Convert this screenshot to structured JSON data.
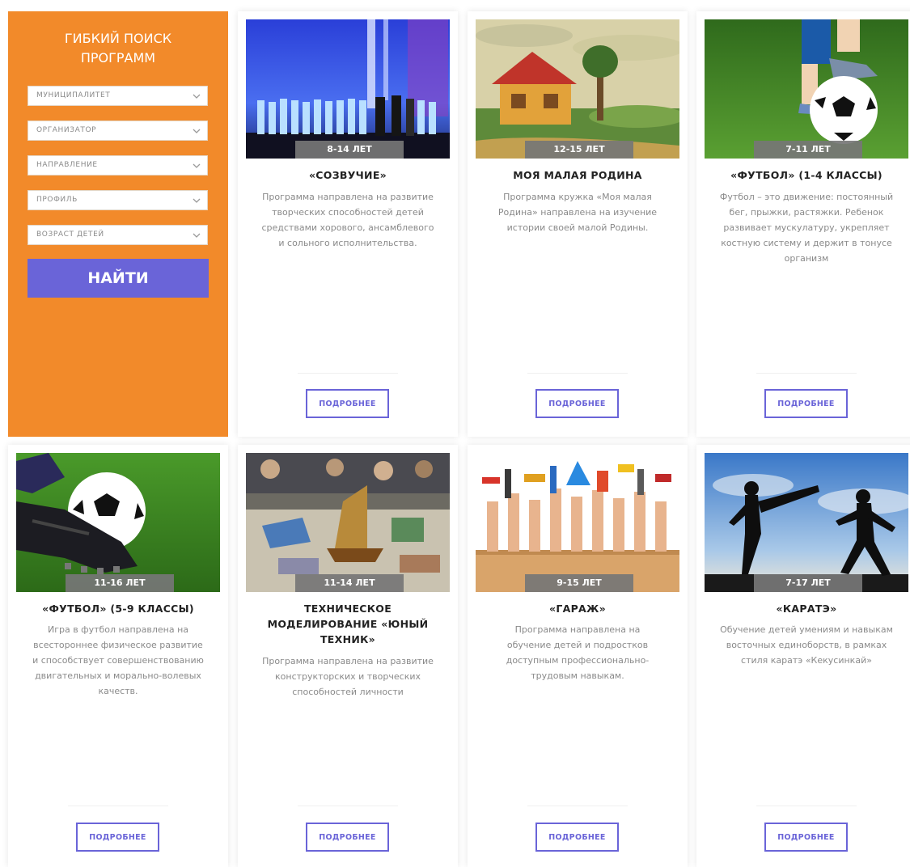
{
  "search": {
    "title_line1": "ГИБКИЙ ПОИСК",
    "title_line2": "ПРОГРАММ",
    "filters": [
      {
        "label": "МУНИЦИПАЛИТЕТ"
      },
      {
        "label": "ОРГАНИЗАТОР"
      },
      {
        "label": "НАПРАВЛЕНИЕ"
      },
      {
        "label": "ПРОФИЛЬ"
      },
      {
        "label": "ВОЗРАСТ ДЕТЕЙ"
      }
    ],
    "button_label": "НАЙТИ",
    "accent_color": "#f28a2a",
    "button_color": "#6a64d8"
  },
  "cards": [
    {
      "age": "8-14 ЛЕТ",
      "title_lines": [
        "«СОЗВУЧИЕ»"
      ],
      "desc_lines": [
        "Программа направлена на развитие",
        "творческих способностей детей",
        "средствами хорового, ансамблевого",
        "и сольного исполнительства."
      ],
      "button": "ПОДРОБНЕЕ",
      "image": "choir-stage"
    },
    {
      "age": "12-15 ЛЕТ",
      "title_lines": [
        "МОЯ МАЛАЯ РОДИНА"
      ],
      "desc_lines": [
        "Программа кружка «Моя малая",
        "Родина» направлена на изучение",
        "истории своей малой Родины."
      ],
      "button": "ПОДРОБНЕЕ",
      "image": "house-painting"
    },
    {
      "age": "7-11 ЛЕТ",
      "title_lines": [
        "«ФУТБОЛ» (1-4 КЛАССЫ)"
      ],
      "desc_lines": [
        "Футбол – это движение: постоянный",
        "бег, прыжки, растяжки. Ребенок",
        "развивает мускулатуру, укрепляет",
        "костную систему и держит в тонусе",
        "организм"
      ],
      "button": "ПОДРОБНЕЕ",
      "image": "football-kid"
    },
    {
      "age": "11-16 ЛЕТ",
      "title_lines": [
        "«ФУТБОЛ» (5-9 КЛАССЫ)"
      ],
      "desc_lines": [
        "Игра в футбол направлена на",
        "всестороннее физическое развитие",
        "и способствует совершенствованию",
        "двигательных и морально-волевых",
        "качеств."
      ],
      "button": "ПОДРОБНЕЕ",
      "image": "football-boot"
    },
    {
      "age": "11-14 ЛЕТ",
      "title_lines": [
        "ТЕХНИЧЕСКОЕ",
        "МОДЕЛИРОВАНИЕ «ЮНЫЙ",
        "ТЕХНИК»"
      ],
      "desc_lines": [
        "Программа направлена на развитие",
        "конструкторских и творческих",
        "способностей личности"
      ],
      "button": "ПОДРОБНЕЕ",
      "image": "models-workshop"
    },
    {
      "age": "9-15 ЛЕТ",
      "title_lines": [
        "«ГАРАЖ»"
      ],
      "desc_lines": [
        "Программа направлена на",
        "обучение детей и подростков",
        "доступным профессионально-",
        "трудовым навыкам."
      ],
      "button": "ПОДРОБНЕЕ",
      "image": "hands-tools"
    },
    {
      "age": "7-17 ЛЕТ",
      "title_lines": [
        "«КАРАТЭ»"
      ],
      "desc_lines": [
        "Обучение детей умениям и навыкам",
        "восточных единоборств, в рамках",
        "стиля каратэ «Кекусинкай»"
      ],
      "button": "ПОДРОБНЕЕ",
      "image": "karate-silhouettes"
    }
  ]
}
